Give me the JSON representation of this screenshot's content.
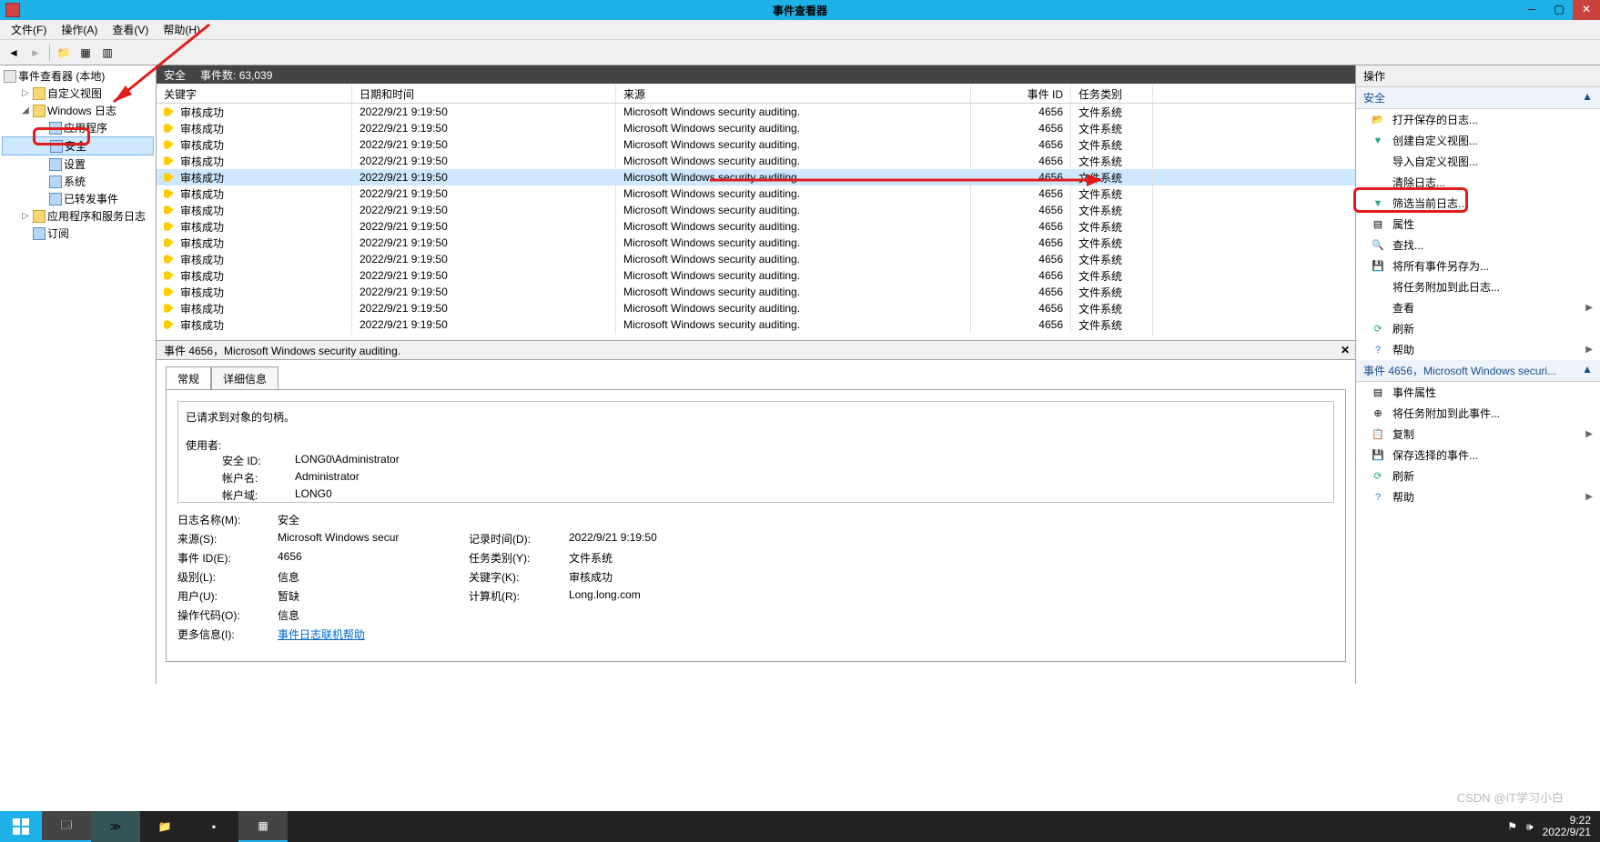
{
  "window": {
    "title": "事件查看器"
  },
  "menu": {
    "file": "文件(F)",
    "action": "操作(A)",
    "view": "查看(V)",
    "help": "帮助(H)"
  },
  "tree": {
    "root": "事件查看器 (本地)",
    "custom_views": "自定义视图",
    "windows_logs": "Windows 日志",
    "application": "应用程序",
    "security": "安全",
    "setup": "设置",
    "system": "系统",
    "forwarded": "已转发事件",
    "app_services": "应用程序和服务日志",
    "subscriptions": "订阅"
  },
  "list_bar": {
    "name": "安全",
    "count_label": "事件数:",
    "count": "63,039"
  },
  "cols": {
    "key": "关键字",
    "date": "日期和时间",
    "src": "来源",
    "id": "事件 ID",
    "cat": "任务类别"
  },
  "row": {
    "key": "审核成功",
    "date": "2022/9/21 9:19:50",
    "src": "Microsoft Windows security auditing.",
    "id": "4656",
    "cat": "文件系统"
  },
  "details": {
    "header": "事件 4656，Microsoft Windows security auditing.",
    "tab_general": "常规",
    "tab_detail": "详细信息",
    "desc_line1": "已请求到对象的句柄。",
    "desc_user_label": "使用者:",
    "desc_sid_label": "安全 ID:",
    "desc_sid": "LONG0\\Administrator",
    "desc_account_label": "帐户名:",
    "desc_account": "Administrator",
    "desc_domain_label": "帐户域:",
    "desc_domain": "LONG0",
    "logname_label": "日志名称(M):",
    "logname": "安全",
    "source_label": "来源(S):",
    "source": "Microsoft Windows secur",
    "logged_label": "记录时间(D):",
    "logged": "2022/9/21 9:19:50",
    "eventid_label": "事件 ID(E):",
    "eventid": "4656",
    "taskcat_label": "任务类别(Y):",
    "taskcat": "文件系统",
    "level_label": "级别(L):",
    "level": "信息",
    "keywords_label": "关键字(K):",
    "keywords": "审核成功",
    "user_label": "用户(U):",
    "user": "暂缺",
    "computer_label": "计算机(R):",
    "computer": "Long.long.com",
    "opcode_label": "操作代码(O):",
    "opcode": "信息",
    "moreinfo_label": "更多信息(I):",
    "moreinfo_link": "事件日志联机帮助"
  },
  "actions": {
    "title": "操作",
    "section1": "安全",
    "open_saved": "打开保存的日志...",
    "create_custom": "创建自定义视图...",
    "import_custom": "导入自定义视图...",
    "clear_log": "清除日志...",
    "filter_current": "筛选当前日志...",
    "properties": "属性",
    "find": "查找...",
    "save_all": "将所有事件另存为...",
    "attach_task": "将任务附加到此日志...",
    "view": "查看",
    "refresh": "刷新",
    "help": "帮助",
    "section2": "事件 4656，Microsoft Windows securi...",
    "event_props": "事件属性",
    "attach_task_event": "将任务附加到此事件...",
    "copy": "复制",
    "save_selected": "保存选择的事件...",
    "refresh2": "刷新",
    "help2": "帮助"
  },
  "taskbar": {
    "time": "9:22",
    "date": "2022/9/21",
    "watermark": "CSDN @IT学习小白"
  }
}
